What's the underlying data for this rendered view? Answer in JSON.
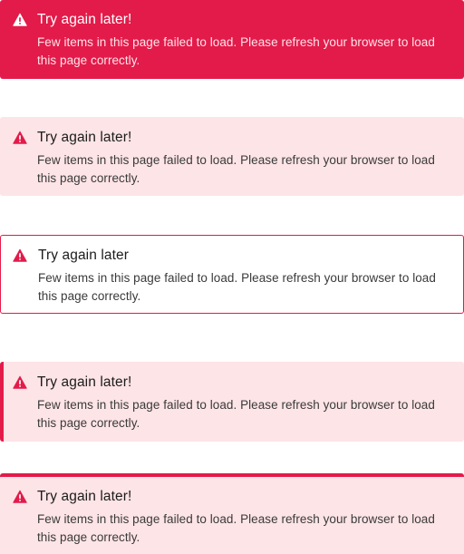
{
  "colors": {
    "accent": "#e31b4a",
    "soft_background": "#fde4e6",
    "solid_text": "#ffffff"
  },
  "alerts": [
    {
      "variant": "solid",
      "icon": "warning-triangle-icon",
      "title": "Try again later!",
      "message": "Few items in this page failed to load. Please refresh your browser to load this page correctly."
    },
    {
      "variant": "soft",
      "icon": "warning-triangle-icon",
      "title": "Try again later!",
      "message": "Few items in this page failed to load. Please refresh your browser to load this page correctly."
    },
    {
      "variant": "outline",
      "icon": "warning-triangle-icon",
      "title": "Try again later",
      "message": "Few items in this page failed to load. Please refresh your browser to load this page correctly."
    },
    {
      "variant": "left-accent",
      "icon": "warning-triangle-icon",
      "title": "Try again later!",
      "message": "Few items in this page failed to load. Please refresh your browser to load this page correctly."
    },
    {
      "variant": "top-accent",
      "icon": "warning-triangle-icon",
      "title": "Try again later!",
      "message": "Few items in this page failed to load. Please refresh your browser to load this page correctly."
    }
  ]
}
